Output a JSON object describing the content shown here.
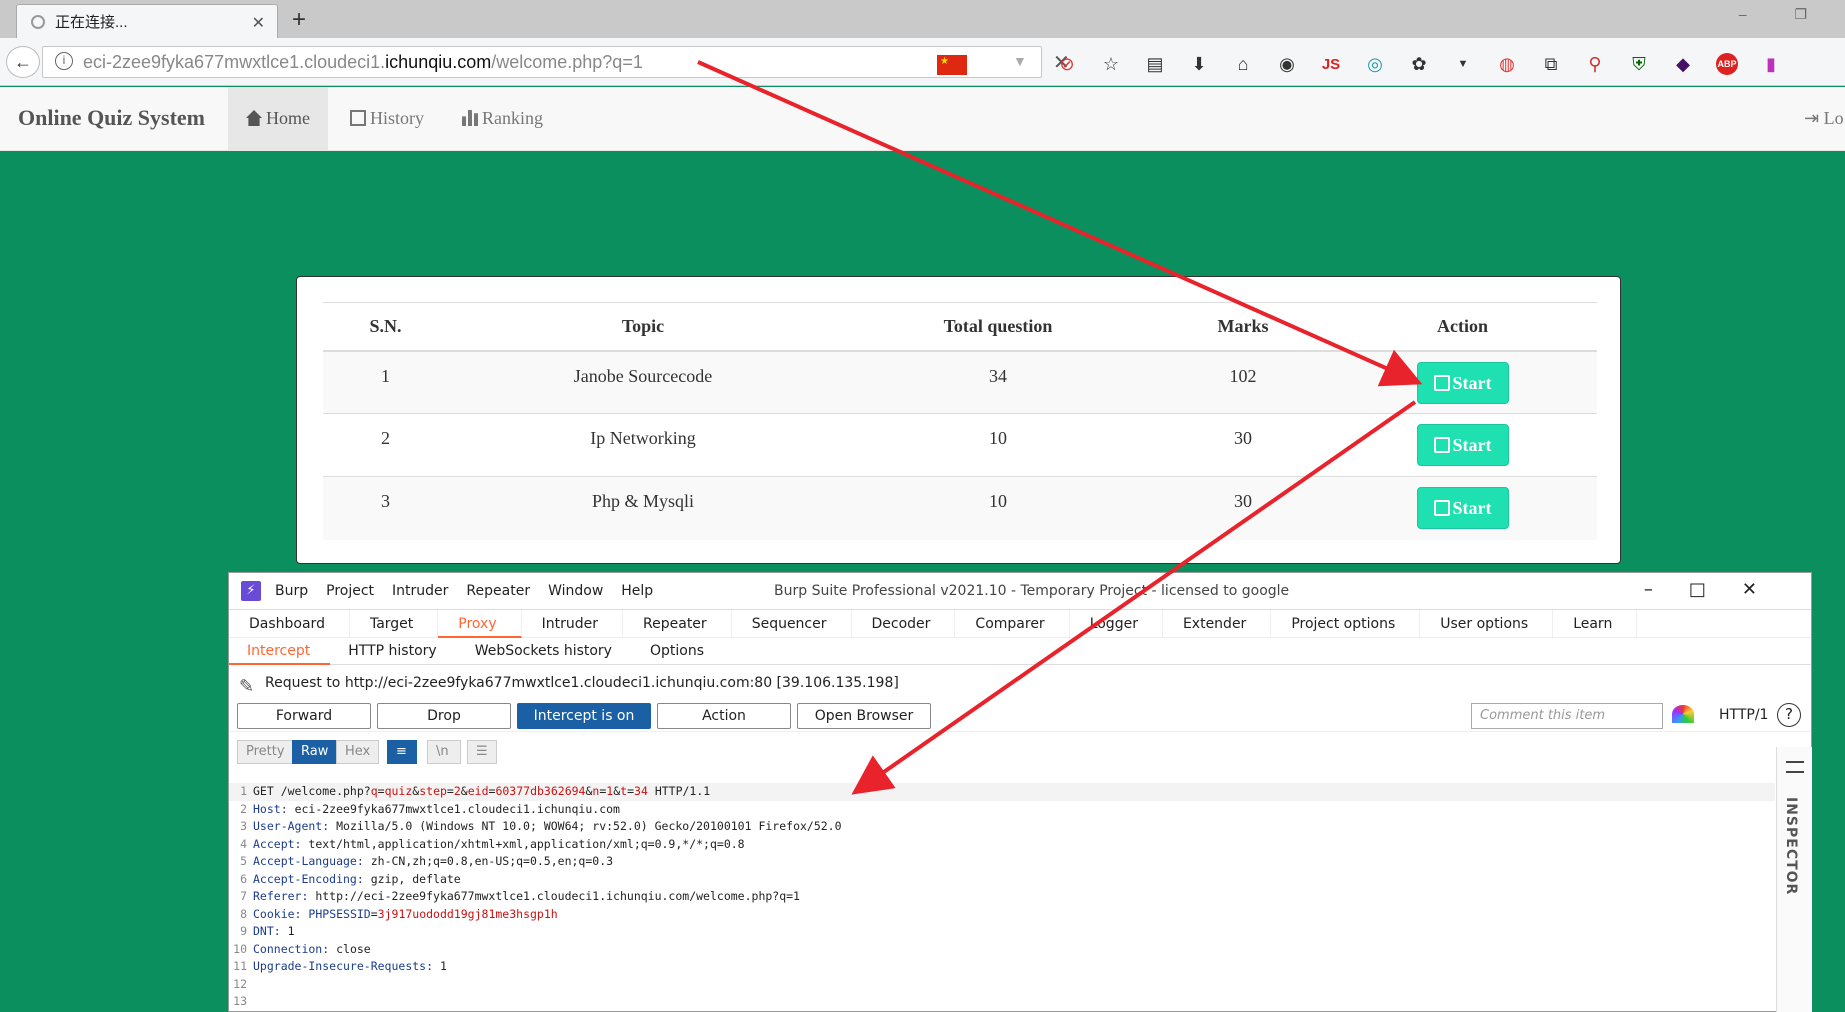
{
  "browser": {
    "tab_title": "正在连接...",
    "url_prefix": "eci-2zee9fyka677mwxtlce1.cloudeci1.",
    "url_domain": "ichunqiu.com",
    "url_suffix": "/welcome.php?q=1",
    "toolbar_js_label": "JS",
    "toolbar_abp_label": "ABP"
  },
  "site": {
    "brand": "Online Quiz System",
    "nav": {
      "home": "Home",
      "history": "History",
      "ranking": "Ranking",
      "logout": "Lo"
    },
    "table": {
      "headers": [
        "S.N.",
        "Topic",
        "Total question",
        "Marks",
        "Action"
      ],
      "rows": [
        {
          "sn": "1",
          "topic": "Janobe Sourcecode",
          "total": "34",
          "marks": "102",
          "action": "Start"
        },
        {
          "sn": "2",
          "topic": "Ip Networking",
          "total": "10",
          "marks": "30",
          "action": "Start"
        },
        {
          "sn": "3",
          "topic": "Php & Mysqli",
          "total": "10",
          "marks": "30",
          "action": "Start"
        }
      ]
    }
  },
  "burp": {
    "title": "Burp Suite Professional v2021.10 - Temporary Project - licensed to google",
    "menu": [
      "Burp",
      "Project",
      "Intruder",
      "Repeater",
      "Window",
      "Help"
    ],
    "tabs": [
      "Dashboard",
      "Target",
      "Proxy",
      "Intruder",
      "Repeater",
      "Sequencer",
      "Decoder",
      "Comparer",
      "Logger",
      "Extender",
      "Project options",
      "User options",
      "Learn"
    ],
    "subtabs": [
      "Intercept",
      "HTTP history",
      "WebSockets history",
      "Options"
    ],
    "request_line": "Request to http://eci-2zee9fyka677mwxtlce1.cloudeci1.ichunqiu.com:80  [39.106.135.198]",
    "buttons": {
      "forward": "Forward",
      "drop": "Drop",
      "intercept": "Intercept is on",
      "action": "Action",
      "open_browser": "Open Browser"
    },
    "comment_placeholder": "Comment this item",
    "http_version": "HTTP/1",
    "views": {
      "pretty": "Pretty",
      "raw": "Raw",
      "hex": "Hex",
      "newline": "\\n"
    },
    "inspector": "INSPECTOR",
    "request": {
      "l1": {
        "a": "GET /welcome.php?",
        "k1": "q",
        "v1": "quiz",
        "k2": "step",
        "v2": "2",
        "k3": "eid",
        "v3": "60377db362694",
        "k4": "n",
        "v4": "1",
        "k5": "t",
        "v5": "34",
        "z": " HTTP/1.1"
      },
      "headers": [
        {
          "k": "Host",
          "v": " eci-2zee9fyka677mwxtlce1.cloudeci1.ichunqiu.com"
        },
        {
          "k": "User-Agent",
          "v": " Mozilla/5.0 (Windows NT 10.0; WOW64; rv:52.0) Gecko/20100101 Firefox/52.0"
        },
        {
          "k": "Accept",
          "v": " text/html,application/xhtml+xml,application/xml;q=0.9,*/*;q=0.8"
        },
        {
          "k": "Accept-Language",
          "v": " zh-CN,zh;q=0.8,en-US;q=0.5,en;q=0.3"
        },
        {
          "k": "Accept-Encoding",
          "v": " gzip, deflate"
        },
        {
          "k": "Referer",
          "v": " http://eci-2zee9fyka677mwxtlce1.cloudeci1.ichunqiu.com/welcome.php?q=1"
        }
      ],
      "cookie": {
        "k": "Cookie",
        "ck": "PHPSESSID",
        "cv": "3j917uododd19gj81me3hsgp1h"
      },
      "headers2": [
        {
          "k": "DNT",
          "v": " 1"
        },
        {
          "k": "Connection",
          "v": " close"
        },
        {
          "k": "Upgrade-Insecure-Requests",
          "v": " 1"
        }
      ]
    }
  }
}
